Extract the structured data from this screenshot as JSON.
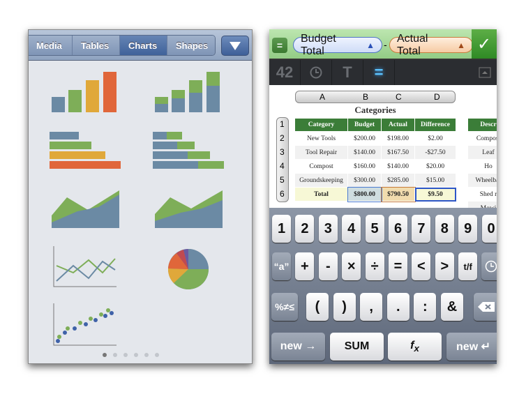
{
  "left_panel": {
    "tabs": [
      {
        "label": "Media"
      },
      {
        "label": "Tables"
      },
      {
        "label": "Charts",
        "selected": true
      },
      {
        "label": "Shapes"
      }
    ],
    "dropdown_icon": "triangle-down-icon",
    "chart_styles": [
      "column",
      "stacked-column",
      "bar",
      "stacked-bar",
      "area",
      "stacked-area",
      "line",
      "pie",
      "scatter"
    ],
    "page_count": 6,
    "current_page": 1,
    "colors": {
      "blue": "#6b8aa4",
      "green": "#7eae58",
      "yellow": "#e0a83a",
      "orange": "#e0663a"
    }
  },
  "right_panel": {
    "formula": {
      "equals_label": "=",
      "token1": "Budget Total",
      "operator": "-",
      "token2": "Actual Total",
      "accept_icon": "checkmark-icon"
    },
    "toolbar": {
      "number_label": "42",
      "date_icon": "clock-icon",
      "text_icon": "T",
      "formula_icon": "equals-icon",
      "hide_icon": "keyboard-hide-icon"
    },
    "sheet": {
      "columns": [
        "A",
        "B",
        "C",
        "D"
      ],
      "rows": [
        "1",
        "2",
        "3",
        "4",
        "5",
        "6"
      ],
      "title": "Categories",
      "headers": [
        "Category",
        "Budget",
        "Actual",
        "Difference"
      ],
      "data": [
        [
          "New Tools",
          "$200.00",
          "$198.00",
          "$2.00"
        ],
        [
          "Tool Repair",
          "$140.00",
          "$167.50",
          "-$27.50"
        ],
        [
          "Compost",
          "$160.00",
          "$140.00",
          "$20.00"
        ],
        [
          "Groundskeeping",
          "$300.00",
          "$285.00",
          "$15.00"
        ],
        [
          "Total",
          "$800.00",
          "$790.50",
          "$9.50"
        ]
      ],
      "table2_header": "Descr",
      "table2_rows": [
        "Compost",
        "Leaf",
        "Ho",
        "Wheelbar",
        "Shed r",
        "Mowi"
      ]
    },
    "keyboard": {
      "row1": [
        "1",
        "2",
        "3",
        "4",
        "5",
        "6",
        "7",
        "8",
        "9",
        "0"
      ],
      "row2": [
        "“a”",
        "+",
        "-",
        "×",
        "÷",
        "=",
        "<",
        ">",
        "t/f"
      ],
      "row3": [
        "%≠≤",
        "(",
        ")",
        ",",
        ".",
        ":",
        "&"
      ],
      "row4": [
        "new →",
        "SUM",
        "fx",
        "new ↵"
      ]
    }
  }
}
